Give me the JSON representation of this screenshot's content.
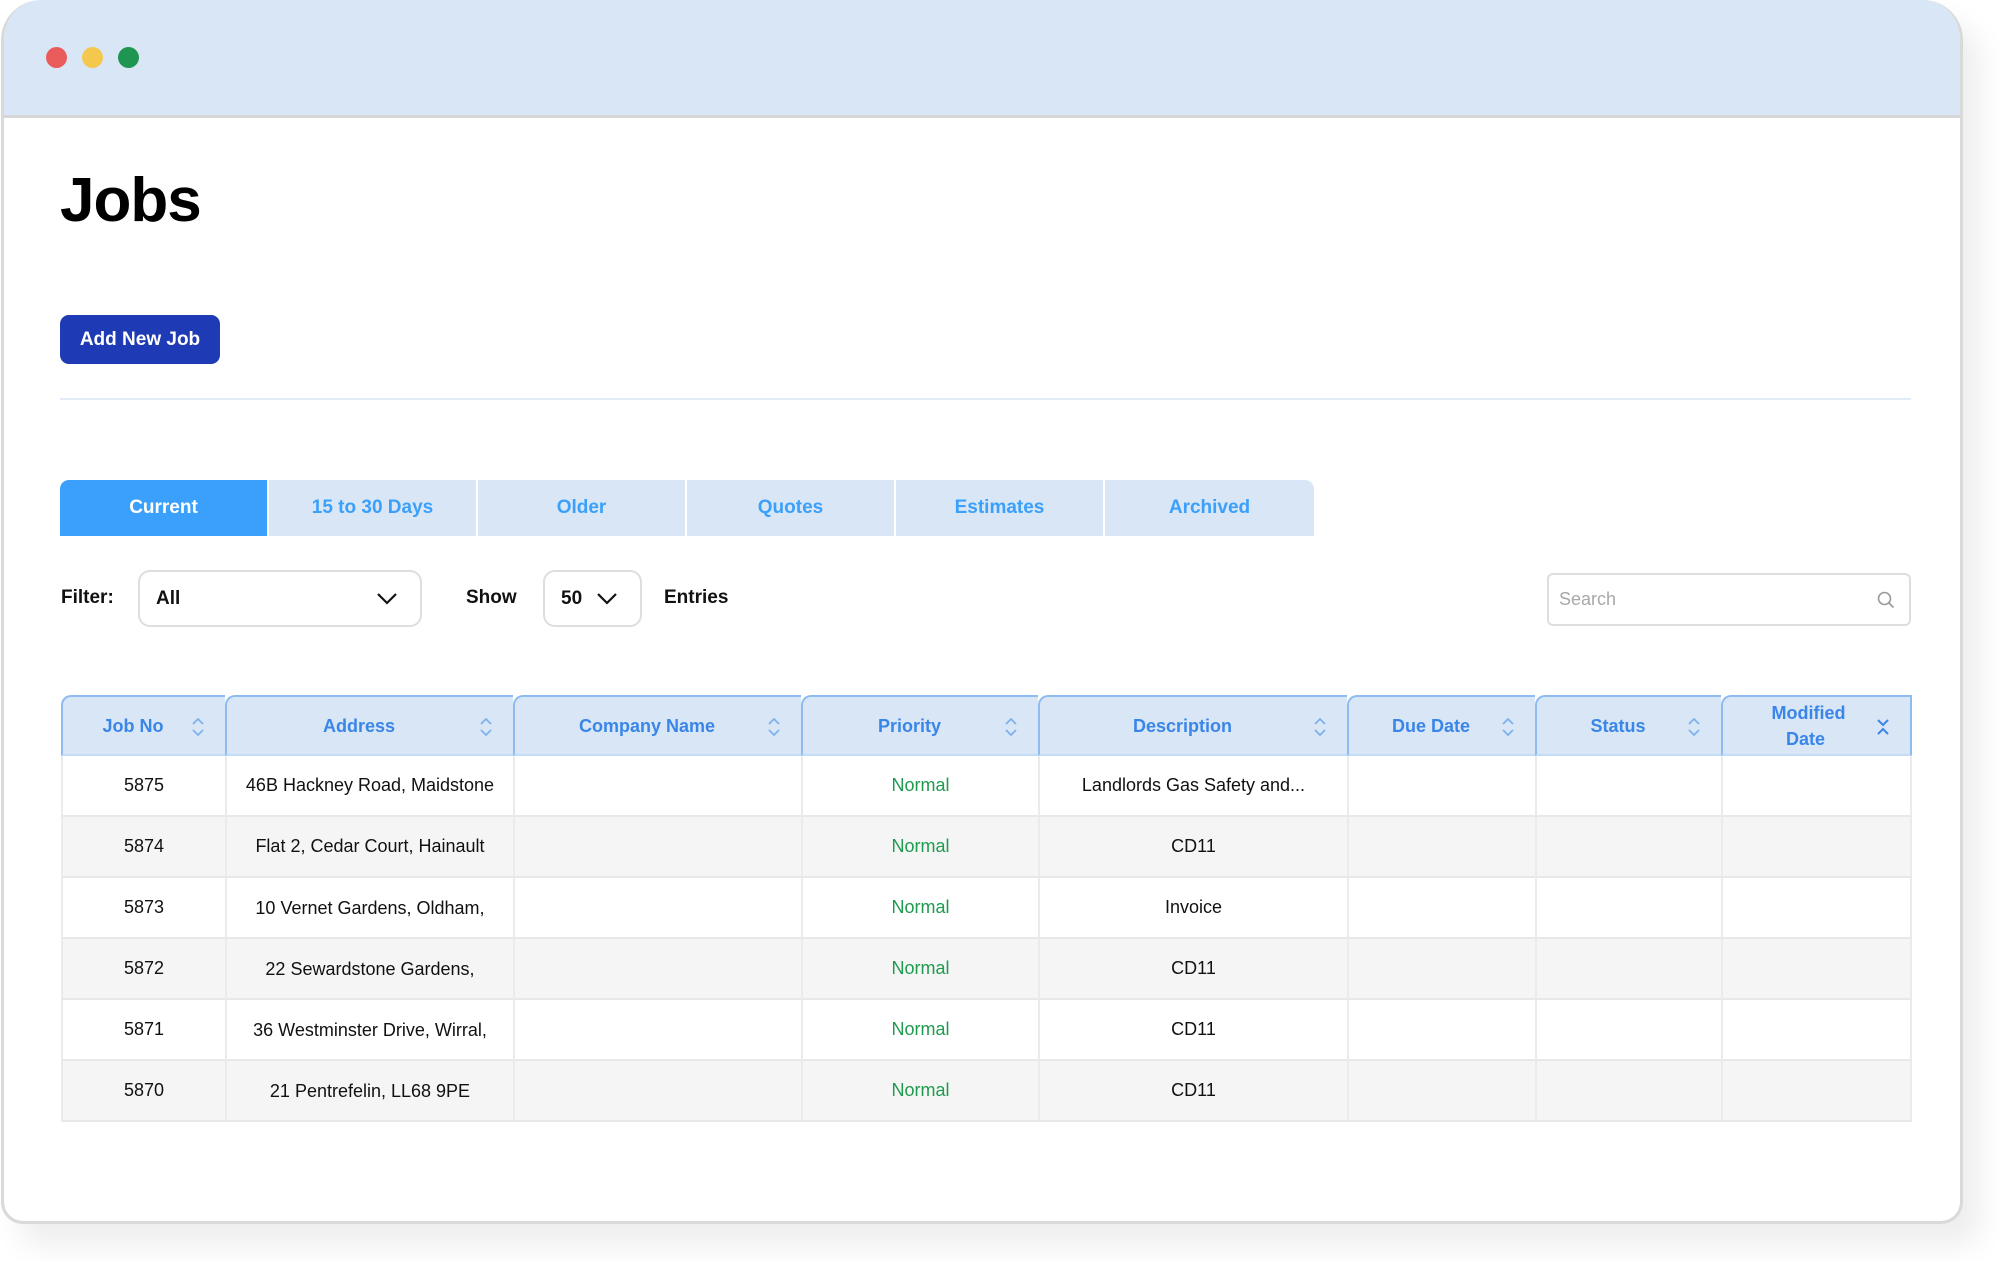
{
  "window": {
    "controls": [
      "close",
      "minimize",
      "maximize"
    ],
    "colors": {
      "close": "#ea5b5b",
      "minimize": "#f4c84d",
      "maximize": "#1f9552",
      "titlebar": "#d8e6f6"
    }
  },
  "page": {
    "title": "Jobs",
    "add_button": "Add New Job"
  },
  "tabs": [
    {
      "label": "Current",
      "active": true
    },
    {
      "label": "15 to 30 Days",
      "active": false
    },
    {
      "label": "Older",
      "active": false
    },
    {
      "label": "Quotes",
      "active": false
    },
    {
      "label": "Estimates",
      "active": false
    },
    {
      "label": "Archived",
      "active": false
    }
  ],
  "controls": {
    "filter_label": "Filter:",
    "filter_value": "All",
    "show_label": "Show",
    "show_value": "50",
    "entries_label": "Entries",
    "search_placeholder": "Search",
    "search_value": ""
  },
  "table": {
    "columns": [
      {
        "label": "Job No",
        "sort": "none"
      },
      {
        "label": "Address",
        "sort": "none"
      },
      {
        "label": "Company Name",
        "sort": "none"
      },
      {
        "label": "Priority",
        "sort": "none"
      },
      {
        "label": "Description",
        "sort": "none"
      },
      {
        "label": "Due Date",
        "sort": "none"
      },
      {
        "label": "Status",
        "sort": "none"
      },
      {
        "label": "Modified Date",
        "sort": "desc"
      }
    ],
    "rows": [
      {
        "job_no": "5875",
        "address": "46B Hackney Road, Maidstone",
        "company": "",
        "priority": "Normal",
        "description": "Landlords Gas Safety and...",
        "due_date": "",
        "status": "",
        "modified": ""
      },
      {
        "job_no": "5874",
        "address": "Flat 2, Cedar Court, Hainault",
        "company": "",
        "priority": "Normal",
        "description": "CD11",
        "due_date": "",
        "status": "",
        "modified": ""
      },
      {
        "job_no": "5873",
        "address": "10 Vernet Gardens, Oldham,",
        "company": "",
        "priority": "Normal",
        "description": "Invoice",
        "due_date": "",
        "status": "",
        "modified": ""
      },
      {
        "job_no": "5872",
        "address": "22 Sewardstone Gardens,",
        "company": "",
        "priority": "Normal",
        "description": "CD11",
        "due_date": "",
        "status": "",
        "modified": ""
      },
      {
        "job_no": "5871",
        "address": "36 Westminster Drive, Wirral,",
        "company": "",
        "priority": "Normal",
        "description": "CD11",
        "due_date": "",
        "status": "",
        "modified": ""
      },
      {
        "job_no": "5870",
        "address": "21 Pentrefelin, LL68 9PE",
        "company": "",
        "priority": "Normal",
        "description": "CD11",
        "due_date": "",
        "status": "",
        "modified": ""
      }
    ]
  },
  "colors": {
    "primary_button": "#1f3ab5",
    "active_tab": "#3aa0fb",
    "tab_bg": "#d8e6f6",
    "header_text": "#3a86e8",
    "priority_normal": "#1e9b4e"
  }
}
